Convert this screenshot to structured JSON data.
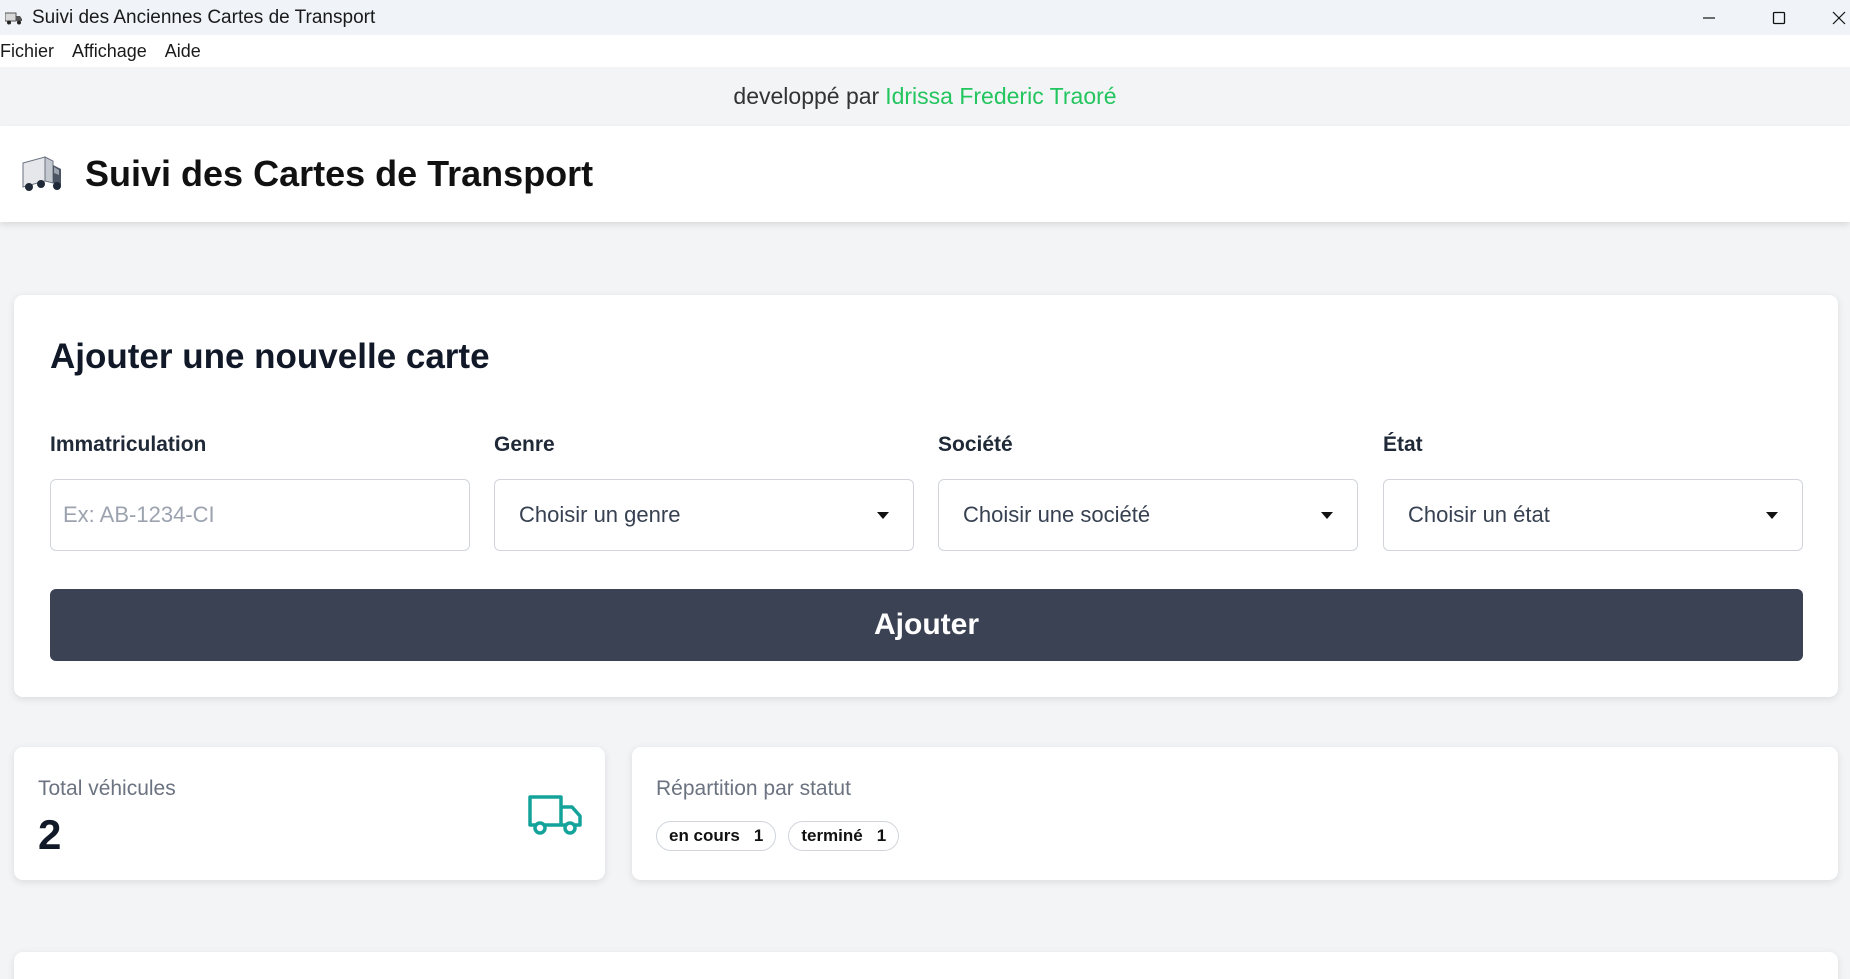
{
  "window": {
    "title": "Suivi des Anciennes Cartes de Transport"
  },
  "menu": [
    "Fichier",
    "Affichage",
    "Aide"
  ],
  "credit": {
    "prefix": "developpé par",
    "author": "Idrissa Frederic Traoré",
    "author_color": "#22c55e"
  },
  "header": {
    "icon": "truck-emoji-icon",
    "title": "Suivi des Cartes de Transport"
  },
  "form": {
    "title": "Ajouter une nouvelle carte",
    "fields": [
      {
        "label": "Immatriculation",
        "type": "text",
        "value": "",
        "placeholder": "Ex: AB-1234-CI"
      },
      {
        "label": "Genre",
        "type": "select",
        "value": "Choisir un genre"
      },
      {
        "label": "Société",
        "type": "select",
        "value": "Choisir une société"
      },
      {
        "label": "État",
        "type": "select",
        "value": "Choisir un état"
      }
    ],
    "submit_label": "Ajouter",
    "submit_color": "#3b4253"
  },
  "stats": {
    "total": {
      "label": "Total véhicules",
      "value": "2",
      "icon": "truck-outline-icon",
      "icon_color": "#14a39a"
    },
    "status": {
      "label": "Répartition par statut",
      "items": [
        {
          "name": "en cours",
          "count": "1"
        },
        {
          "name": "terminé",
          "count": "1"
        }
      ]
    }
  }
}
